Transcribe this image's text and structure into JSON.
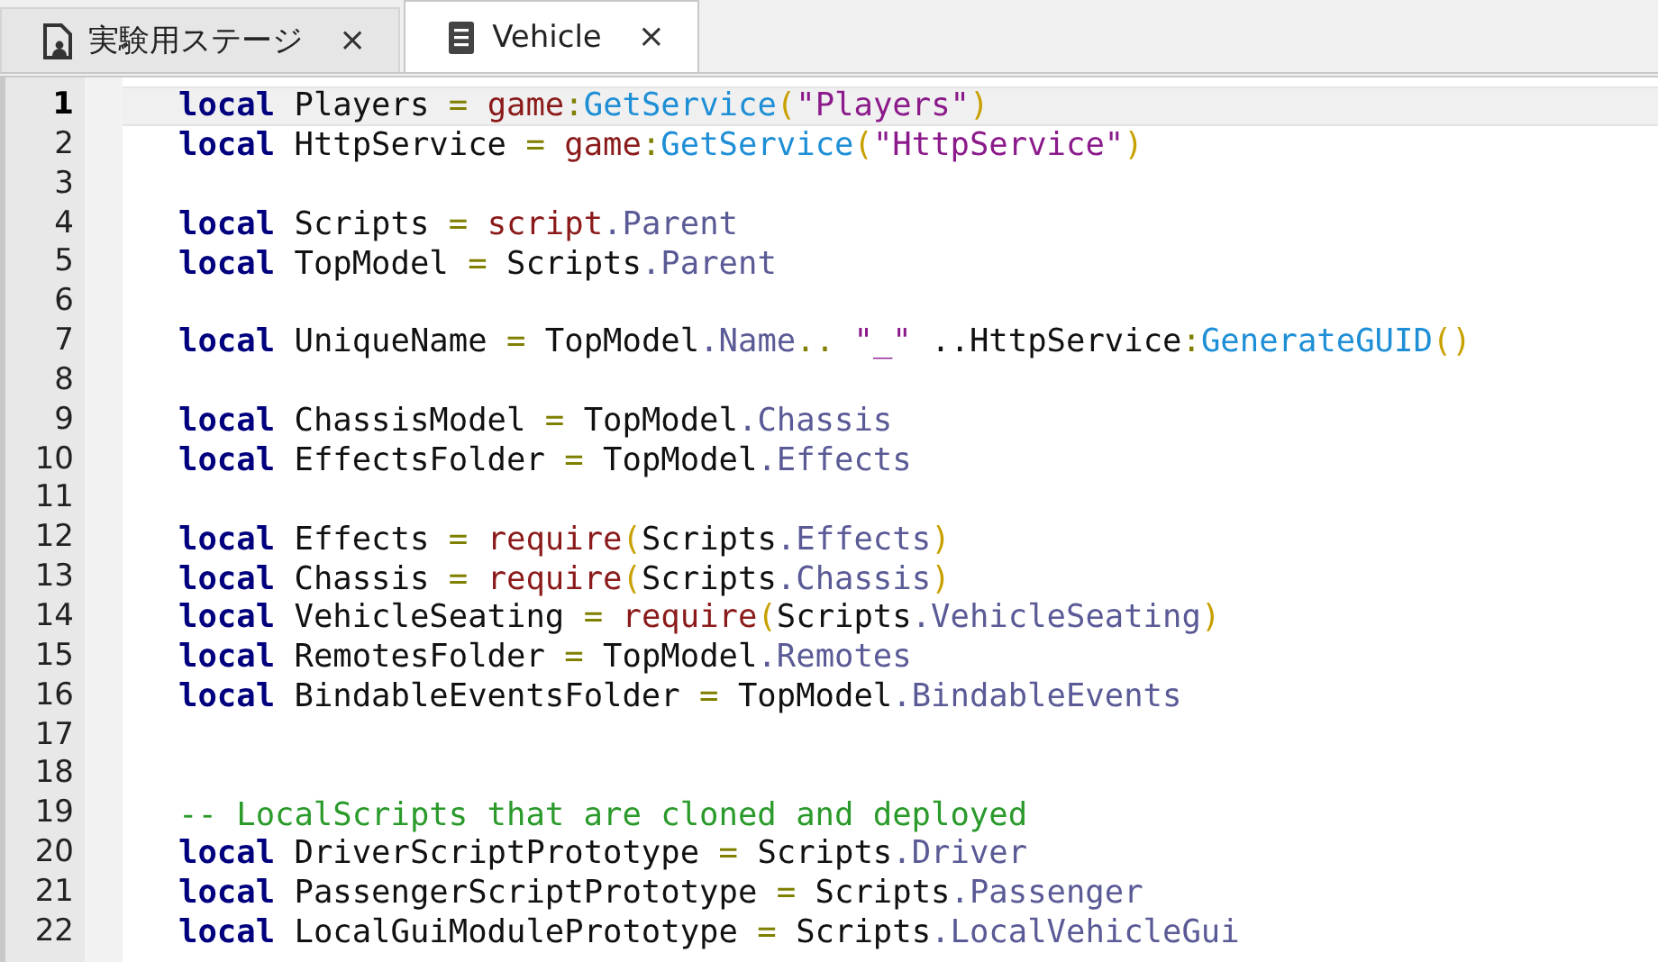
{
  "tabs": [
    {
      "label": "実験用ステージ",
      "selected": false,
      "close": "×"
    },
    {
      "label": "Vehicle",
      "selected": true,
      "close": "×"
    }
  ],
  "editor": {
    "lines": [
      {
        "number": "1",
        "current": true,
        "tokens": [
          {
            "kind": "keyword",
            "text": "local"
          },
          {
            "kind": "plain",
            "text": " Players "
          },
          {
            "kind": "operator",
            "text": "= "
          },
          {
            "kind": "builtin",
            "text": "game"
          },
          {
            "kind": "operator",
            "text": ":"
          },
          {
            "kind": "method",
            "text": "GetService"
          },
          {
            "kind": "paren",
            "text": "("
          },
          {
            "kind": "string",
            "text": "\"Players\""
          },
          {
            "kind": "paren",
            "text": ")"
          }
        ]
      },
      {
        "number": "2",
        "current": false,
        "tokens": [
          {
            "kind": "keyword",
            "text": "local"
          },
          {
            "kind": "plain",
            "text": " HttpService "
          },
          {
            "kind": "operator",
            "text": "= "
          },
          {
            "kind": "builtin",
            "text": "game"
          },
          {
            "kind": "operator",
            "text": ":"
          },
          {
            "kind": "method",
            "text": "GetService"
          },
          {
            "kind": "paren",
            "text": "("
          },
          {
            "kind": "string",
            "text": "\"HttpService\""
          },
          {
            "kind": "paren",
            "text": ")"
          }
        ]
      },
      {
        "number": "3",
        "current": false
      },
      {
        "number": "4",
        "current": false,
        "tokens": [
          {
            "kind": "keyword",
            "text": "local"
          },
          {
            "kind": "plain",
            "text": " Scripts "
          },
          {
            "kind": "operator",
            "text": "= "
          },
          {
            "kind": "builtin",
            "text": "script"
          },
          {
            "kind": "property",
            "text": ".Parent"
          }
        ]
      },
      {
        "number": "5",
        "current": false,
        "tokens": [
          {
            "kind": "keyword",
            "text": "local"
          },
          {
            "kind": "plain",
            "text": " TopModel "
          },
          {
            "kind": "operator",
            "text": "="
          },
          {
            "kind": "plain",
            "text": " Scripts"
          },
          {
            "kind": "property",
            "text": ".Parent"
          }
        ]
      },
      {
        "number": "6",
        "current": false
      },
      {
        "number": "7",
        "current": false,
        "tokens": [
          {
            "kind": "keyword",
            "text": "local"
          },
          {
            "kind": "plain",
            "text": " UniqueName "
          },
          {
            "kind": "operator",
            "text": "="
          },
          {
            "kind": "plain",
            "text": " TopModel"
          },
          {
            "kind": "property",
            "text": ".Name"
          },
          {
            "kind": "operator",
            "text": ".. "
          },
          {
            "kind": "string",
            "text": "\"_\""
          },
          {
            "kind": "plain",
            "text": " ..HttpService"
          },
          {
            "kind": "operator",
            "text": ":"
          },
          {
            "kind": "method",
            "text": "GenerateGUID"
          },
          {
            "kind": "paren",
            "text": "()"
          }
        ]
      },
      {
        "number": "8",
        "current": false
      },
      {
        "number": "9",
        "current": false,
        "tokens": [
          {
            "kind": "keyword",
            "text": "local"
          },
          {
            "kind": "plain",
            "text": " ChassisModel "
          },
          {
            "kind": "operator",
            "text": "="
          },
          {
            "kind": "plain",
            "text": " TopModel"
          },
          {
            "kind": "property",
            "text": ".Chassis"
          }
        ]
      },
      {
        "number": "10",
        "current": false,
        "tokens": [
          {
            "kind": "keyword",
            "text": "local"
          },
          {
            "kind": "plain",
            "text": " EffectsFolder "
          },
          {
            "kind": "operator",
            "text": "="
          },
          {
            "kind": "plain",
            "text": " TopModel"
          },
          {
            "kind": "property",
            "text": ".Effects"
          }
        ]
      },
      {
        "number": "11",
        "current": false
      },
      {
        "number": "12",
        "current": false,
        "tokens": [
          {
            "kind": "keyword",
            "text": "local"
          },
          {
            "kind": "plain",
            "text": " Effects "
          },
          {
            "kind": "operator",
            "text": "= "
          },
          {
            "kind": "builtin",
            "text": "require"
          },
          {
            "kind": "paren",
            "text": "("
          },
          {
            "kind": "plain",
            "text": "Scripts"
          },
          {
            "kind": "property",
            "text": ".Effects"
          },
          {
            "kind": "paren",
            "text": ")"
          }
        ]
      },
      {
        "number": "13",
        "current": false,
        "tokens": [
          {
            "kind": "keyword",
            "text": "local"
          },
          {
            "kind": "plain",
            "text": " Chassis "
          },
          {
            "kind": "operator",
            "text": "= "
          },
          {
            "kind": "builtin",
            "text": "require"
          },
          {
            "kind": "paren",
            "text": "("
          },
          {
            "kind": "plain",
            "text": "Scripts"
          },
          {
            "kind": "property",
            "text": ".Chassis"
          },
          {
            "kind": "paren",
            "text": ")"
          }
        ]
      },
      {
        "number": "14",
        "current": false,
        "tokens": [
          {
            "kind": "keyword",
            "text": "local"
          },
          {
            "kind": "plain",
            "text": " VehicleSeating "
          },
          {
            "kind": "operator",
            "text": "= "
          },
          {
            "kind": "builtin",
            "text": "require"
          },
          {
            "kind": "paren",
            "text": "("
          },
          {
            "kind": "plain",
            "text": "Scripts"
          },
          {
            "kind": "property",
            "text": ".VehicleSeating"
          },
          {
            "kind": "paren",
            "text": ")"
          }
        ]
      },
      {
        "number": "15",
        "current": false,
        "tokens": [
          {
            "kind": "keyword",
            "text": "local"
          },
          {
            "kind": "plain",
            "text": " RemotesFolder "
          },
          {
            "kind": "operator",
            "text": "="
          },
          {
            "kind": "plain",
            "text": " TopModel"
          },
          {
            "kind": "property",
            "text": ".Remotes"
          }
        ]
      },
      {
        "number": "16",
        "current": false,
        "tokens": [
          {
            "kind": "keyword",
            "text": "local"
          },
          {
            "kind": "plain",
            "text": " BindableEventsFolder "
          },
          {
            "kind": "operator",
            "text": "="
          },
          {
            "kind": "plain",
            "text": " TopModel"
          },
          {
            "kind": "property",
            "text": ".BindableEvents"
          }
        ]
      },
      {
        "number": "17",
        "current": false
      },
      {
        "number": "18",
        "current": false
      },
      {
        "number": "19",
        "current": false,
        "tokens": [
          {
            "kind": "comment",
            "text": "-- LocalScripts that are cloned and deployed"
          }
        ]
      },
      {
        "number": "20",
        "current": false,
        "tokens": [
          {
            "kind": "keyword",
            "text": "local"
          },
          {
            "kind": "plain",
            "text": " DriverScriptPrototype "
          },
          {
            "kind": "operator",
            "text": "="
          },
          {
            "kind": "plain",
            "text": " Scripts"
          },
          {
            "kind": "property",
            "text": ".Driver"
          }
        ]
      },
      {
        "number": "21",
        "current": false,
        "tokens": [
          {
            "kind": "keyword",
            "text": "local"
          },
          {
            "kind": "plain",
            "text": " PassengerScriptPrototype "
          },
          {
            "kind": "operator",
            "text": "="
          },
          {
            "kind": "plain",
            "text": " Scripts"
          },
          {
            "kind": "property",
            "text": ".Passenger"
          }
        ]
      },
      {
        "number": "22",
        "current": false,
        "tokens": [
          {
            "kind": "keyword",
            "text": "local"
          },
          {
            "kind": "plain",
            "text": " LocalGuiModulePrototype "
          },
          {
            "kind": "operator",
            "text": "="
          },
          {
            "kind": "plain",
            "text": " Scripts"
          },
          {
            "kind": "property",
            "text": ".LocalVehicleGui"
          }
        ]
      }
    ]
  }
}
